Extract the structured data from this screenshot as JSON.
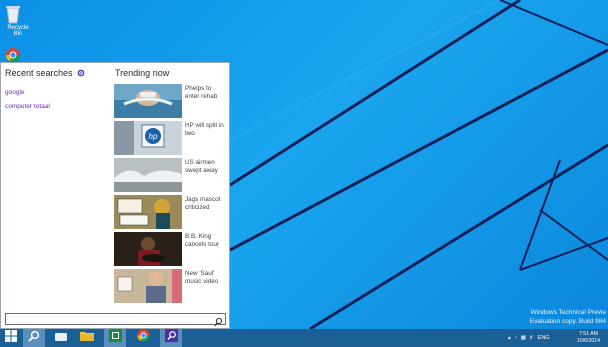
{
  "desktop": {
    "icons": [
      {
        "label": "Recycle Bin",
        "icon": "recycle-bin-icon"
      },
      {
        "label": "",
        "icon": "chrome-icon"
      }
    ],
    "watermark": {
      "line1": "Windows Technical Previe",
      "line2": "Evaluation copy. Build 984"
    }
  },
  "search_panel": {
    "recent_title": "Recent searches",
    "recent_items": [
      "google",
      "computer totaal"
    ],
    "trending_title": "Trending now",
    "trending": [
      {
        "label": "Phelps to enter rehab",
        "thumb": "swimmer"
      },
      {
        "label": "HP will split in two",
        "thumb": "hp-sign"
      },
      {
        "label": "US airmen swept away",
        "thumb": "waves"
      },
      {
        "label": "Jags mascot criticized",
        "thumb": "ebola-sign"
      },
      {
        "label": "B.B. King cancels tour",
        "thumb": "guitarist"
      },
      {
        "label": "New 'Saul' music video",
        "thumb": "saul"
      }
    ],
    "search_placeholder": ""
  },
  "taskbar": {
    "buttons": [
      {
        "name": "start-button",
        "icon": "windows-logo-icon"
      },
      {
        "name": "search-button",
        "icon": "search-icon"
      },
      {
        "name": "task-view-button",
        "icon": "task-view-icon"
      },
      {
        "name": "file-explorer-button",
        "icon": "folder-icon"
      },
      {
        "name": "store-button",
        "icon": "store-icon"
      },
      {
        "name": "chrome-button",
        "icon": "chrome-icon"
      },
      {
        "name": "search-app-button",
        "icon": "search-icon"
      }
    ],
    "tray_lang": "ENG",
    "clock_time": "7:51 AM",
    "clock_date": "10/6/2014"
  },
  "colors": {
    "desktop_bg": "#0a8fe6",
    "taskbar_bg": "#1a5f95",
    "recent_link": "#6a2fb0"
  }
}
